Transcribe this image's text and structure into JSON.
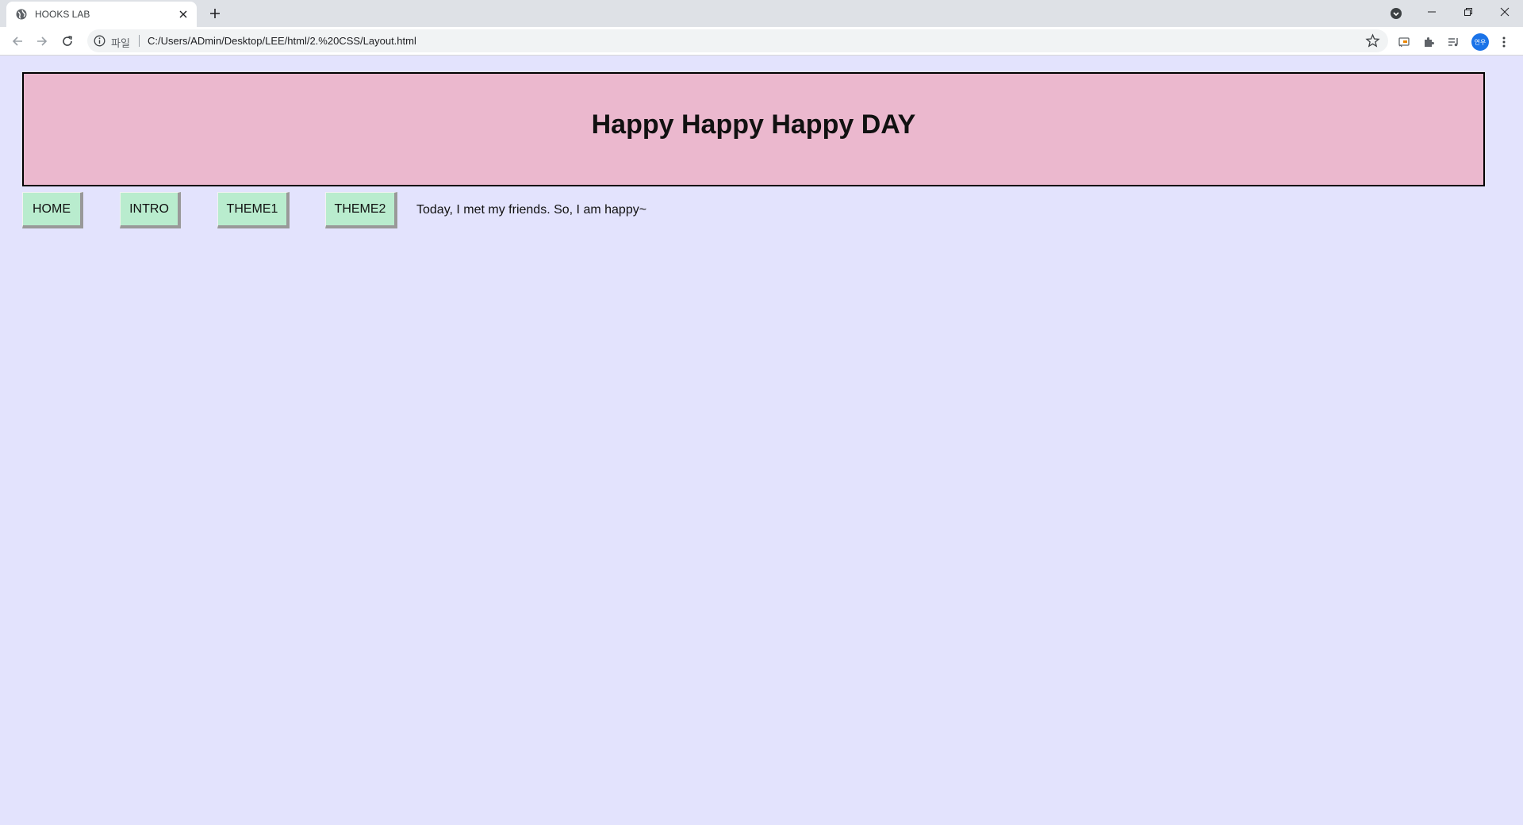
{
  "browser": {
    "tab_title": "HOOKS LAB",
    "scheme_label": "파일",
    "url": "C:/Users/ADmin/Desktop/LEE/html/2.%20CSS/Layout.html",
    "avatar_initials": "연우"
  },
  "page": {
    "header_title": "Happy Happy Happy DAY",
    "nav": {
      "items": [
        {
          "label": "HOME"
        },
        {
          "label": "INTRO"
        },
        {
          "label": "THEME1"
        },
        {
          "label": "THEME2"
        }
      ]
    },
    "content_text": "Today, I met my friends. So, I am happy~"
  },
  "colors": {
    "page_background": "#e3e3fd",
    "header_background": "#ebb8ce",
    "nav_button_background": "#b9ecce",
    "nav_button_shadow": "#999999"
  }
}
